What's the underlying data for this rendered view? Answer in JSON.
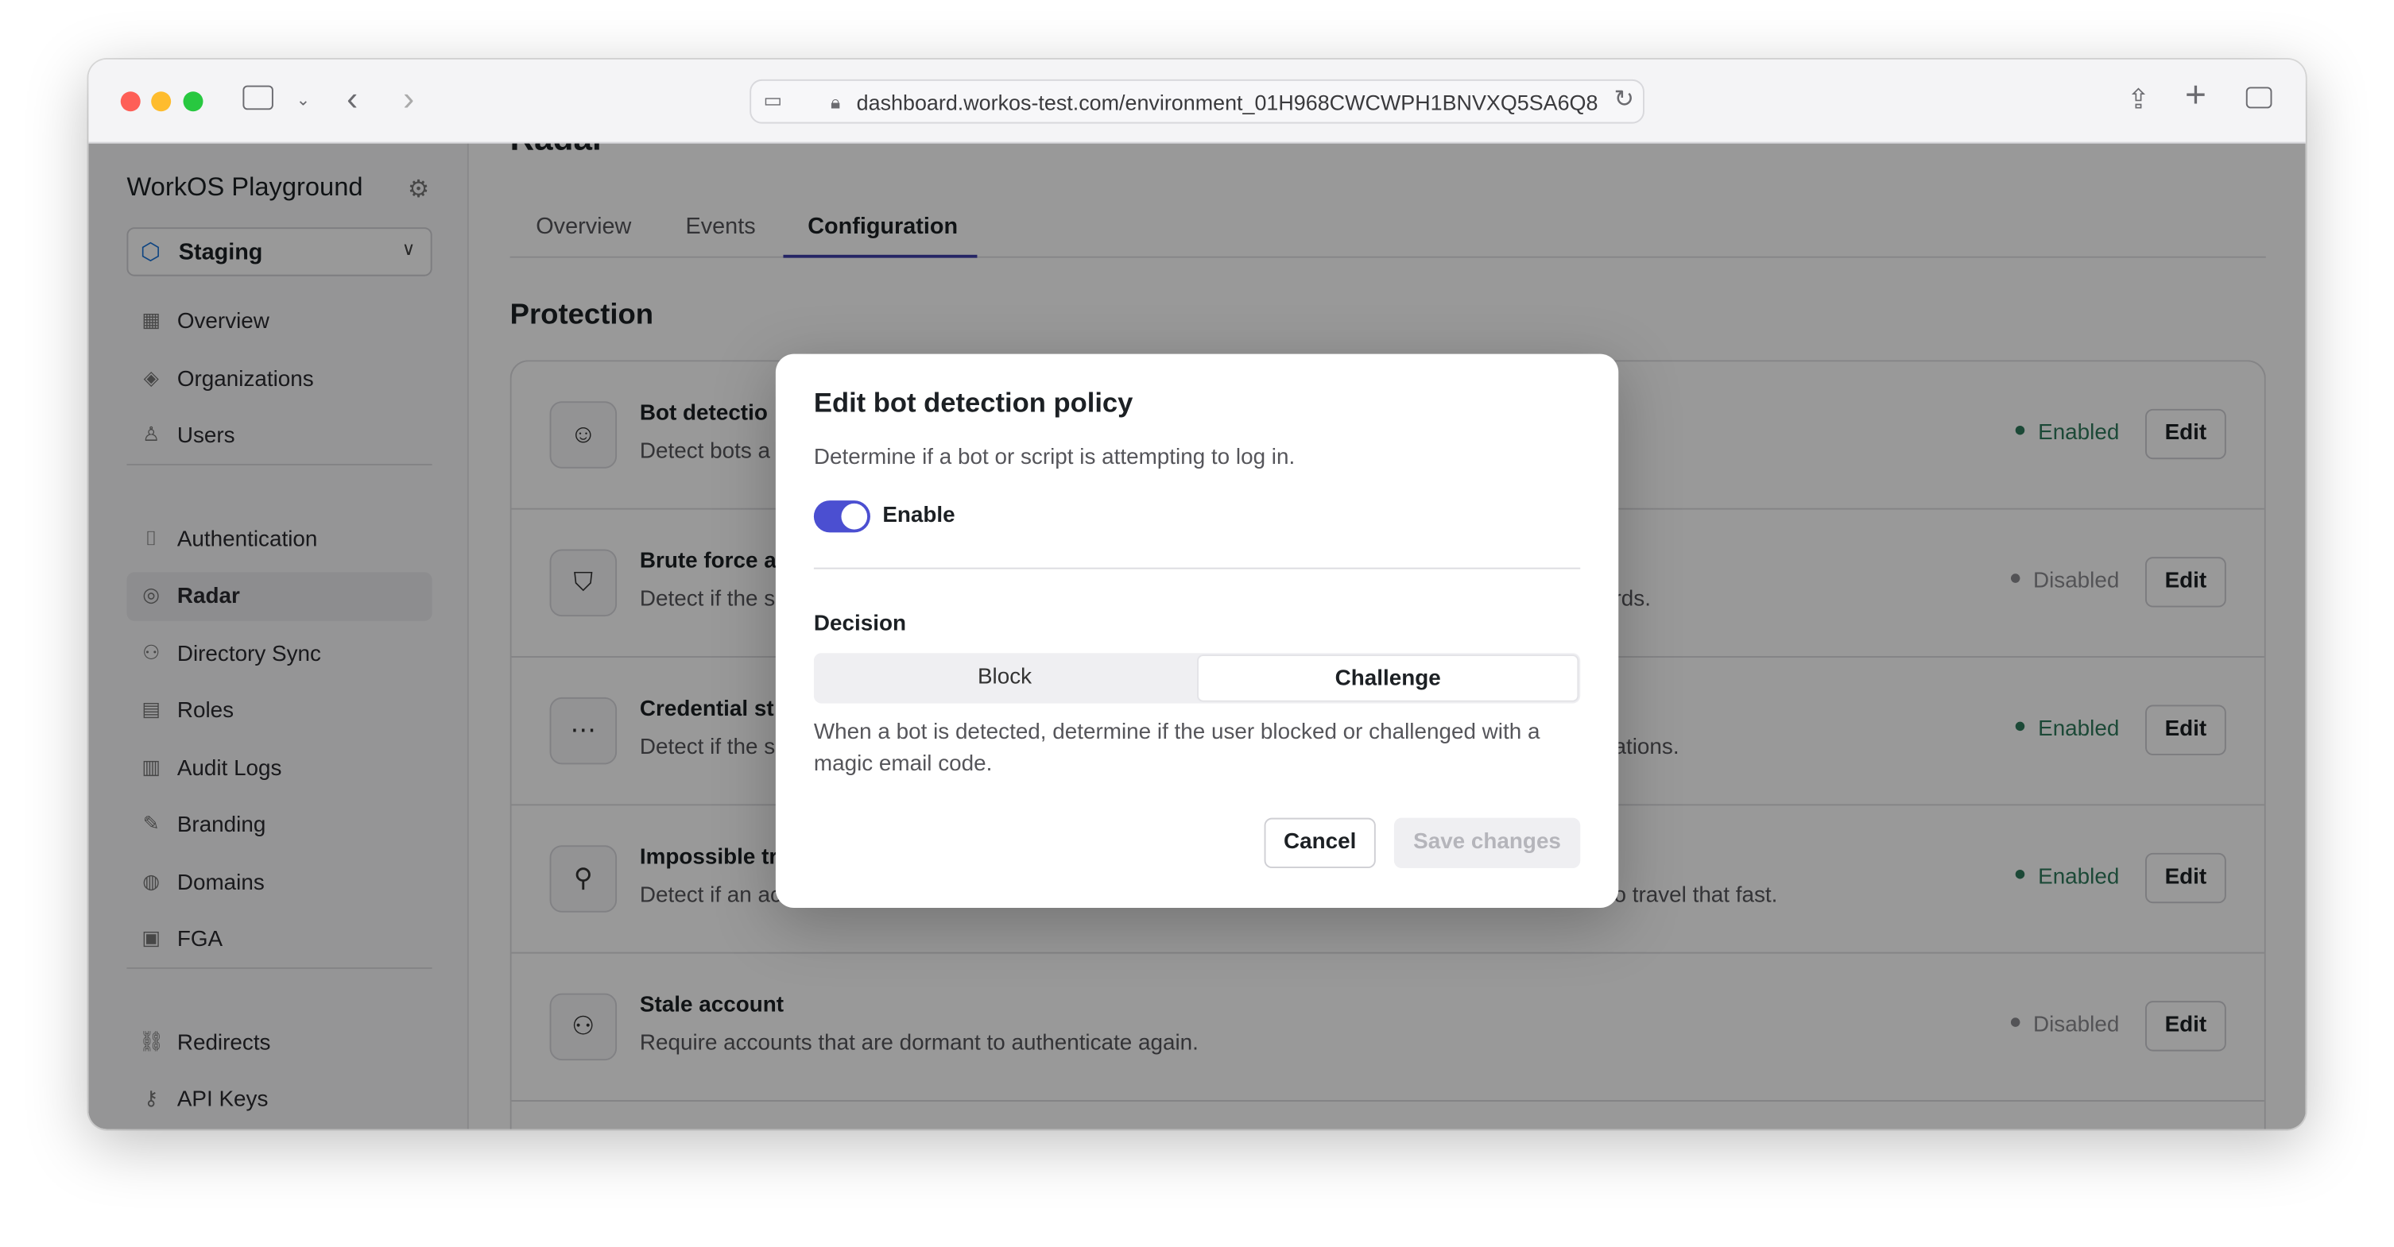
{
  "browser": {
    "url": "dashboard.workos-test.com/environment_01H968CWCWPH1BNVXQ5SA6Q8",
    "icons": [
      "sidebar-toggle-icon",
      "chevron-down-icon",
      "back-icon",
      "forward-icon",
      "site-settings-icon",
      "lock-icon",
      "reload-icon",
      "share-icon",
      "new-tab-icon",
      "tabs-overview-icon"
    ]
  },
  "sidebar": {
    "org_name": "WorkOS Playground",
    "environment": "Staging",
    "groups": [
      [
        {
          "label": "Overview",
          "icon": "grid-icon"
        },
        {
          "label": "Organizations",
          "icon": "layers-icon"
        },
        {
          "label": "Users",
          "icon": "user-icon"
        }
      ],
      [
        {
          "label": "Authentication",
          "icon": "key-icon"
        },
        {
          "label": "Radar",
          "icon": "radar-icon",
          "active": true
        },
        {
          "label": "Directory Sync",
          "icon": "users-sync-icon"
        },
        {
          "label": "Roles",
          "icon": "id-card-icon"
        },
        {
          "label": "Audit Logs",
          "icon": "logs-icon"
        },
        {
          "label": "Branding",
          "icon": "brush-icon"
        },
        {
          "label": "Domains",
          "icon": "globe-icon"
        },
        {
          "label": "FGA",
          "icon": "fga-icon"
        }
      ],
      [
        {
          "label": "Redirects",
          "icon": "link-icon"
        },
        {
          "label": "API Keys",
          "icon": "api-key-icon"
        }
      ]
    ]
  },
  "main": {
    "page_title": "Radar",
    "tabs": [
      {
        "label": "Overview"
      },
      {
        "label": "Events"
      },
      {
        "label": "Configuration",
        "active": true
      }
    ],
    "section_title": "Protection",
    "rows": [
      {
        "title": "Bot detectio",
        "desc": "Detect bots a",
        "tail": "",
        "status": "Enabled",
        "edit": "Edit",
        "icon": "robot-icon"
      },
      {
        "title": "Brute force a",
        "desc": "Detect if the s",
        "tail": "rds.",
        "status": "Disabled",
        "edit": "Edit",
        "icon": "shield-icon"
      },
      {
        "title": "Credential st",
        "desc": "Detect if the s",
        "tail": "ations.",
        "status": "Enabled",
        "edit": "Edit",
        "icon": "password-icon"
      },
      {
        "title": "Impossible tr",
        "desc": "Detect if an ac",
        "tail": "o travel that fast.",
        "status": "Enabled",
        "edit": "Edit",
        "icon": "location-x-icon"
      },
      {
        "title": "Stale account",
        "desc": "Require accounts that are dormant to authenticate again.",
        "tail": "",
        "status": "Disabled",
        "edit": "Edit",
        "icon": "users-icon"
      }
    ]
  },
  "modal": {
    "title": "Edit bot detection policy",
    "description": "Determine if a bot or script is attempting to log in.",
    "toggle_label": "Enable",
    "toggle_on": true,
    "decision_label": "Decision",
    "options": [
      "Block",
      "Challenge"
    ],
    "selected": "Challenge",
    "help": "When a bot is detected, determine if the user blocked or challenged with a magic email code.",
    "cancel": "Cancel",
    "save": "Save changes"
  },
  "colors": {
    "accent": "#4b4fd1",
    "enabled": "#2f7a5c",
    "disabled": "#8b8b90",
    "tab_underline": "#3e3ea8"
  }
}
